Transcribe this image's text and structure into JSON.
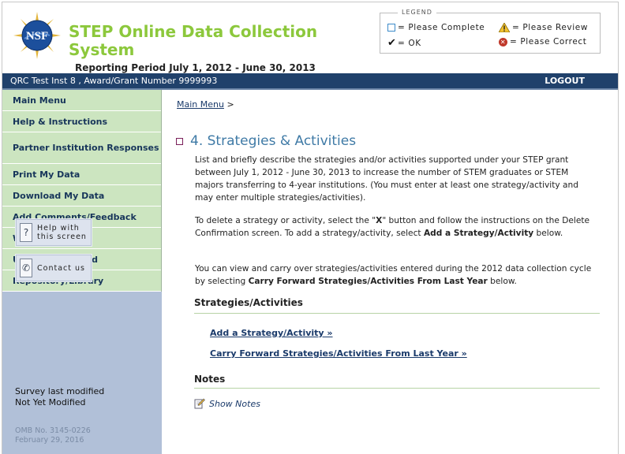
{
  "header": {
    "title": "STEP Online Data Collection System",
    "logo_text": "NSF",
    "reporting_period": "Reporting Period July 1, 2012 - June 30, 2013"
  },
  "legend": {
    "title": "LEGEND",
    "items": {
      "complete": "= Please Complete",
      "review": "= Please Review",
      "ok": "= OK",
      "correct": "= Please Correct"
    }
  },
  "navbar": {
    "institution": "QRC Test Inst 8 , Award/Grant Number 9999993",
    "logout": "LOGOUT"
  },
  "sidebar": {
    "items": [
      {
        "label": "Main Menu"
      },
      {
        "label": "Help & Instructions"
      },
      {
        "label": "Partner Institution Responses"
      },
      {
        "label": "Print My Data"
      },
      {
        "label": "Download My Data"
      },
      {
        "label": "Add Comments/Feedback"
      },
      {
        "label": "Work Offline"
      },
      {
        "label": "Update Password"
      },
      {
        "label": "Repository/Library"
      }
    ],
    "help_button": {
      "line1": "Help with",
      "line2": "this screen"
    },
    "contact_button": "Contact us",
    "survey_label": "Survey last modified",
    "survey_value": "Not Yet Modified",
    "omb_number": "OMB No. 3145-0226",
    "omb_date": "February 29, 2016"
  },
  "main": {
    "breadcrumb": {
      "link": "Main Menu",
      "separator": ">"
    },
    "title": "4. Strategies & Activities",
    "para1": "List and briefly describe the strategies and/or activities supported under your STEP grant between July 1, 2012 - June 30, 2013 to increase the number of STEM graduates or STEM majors transferring to 4-year institutions. (You must enter at least one strategy/activity and may enter multiple strategies/activities).",
    "para2_a": "To delete a strategy or activity, select the \"",
    "para2_x": "X",
    "para2_b": "\" button and follow the instructions on the Delete Confirmation screen. To add a strategy/activity, select ",
    "para2_bold": "Add a Strategy/Activity",
    "para2_c": " below.",
    "para3_a": "You can view and carry over strategies/activities entered during the 2012 data collection cycle by selecting ",
    "para3_bold": "Carry Forward Strategies/Activities From Last Year",
    "para3_c": " below.",
    "strategies_heading": "Strategies/Activities",
    "add_link": "Add a Strategy/Activity »",
    "carry_link": "Carry Forward Strategies/Activities From Last Year »",
    "notes_heading": "Notes",
    "show_notes": "Show Notes"
  }
}
